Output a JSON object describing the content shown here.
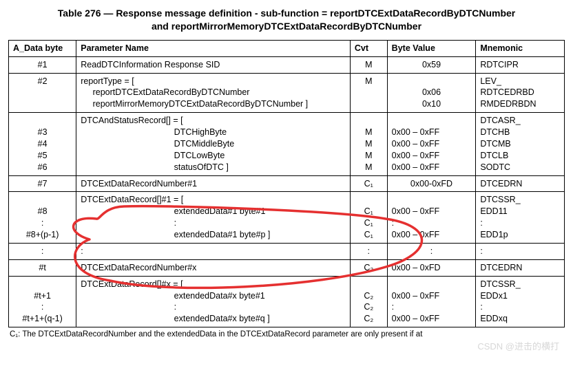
{
  "title_line1": "Table 276 — Response message definition - sub-function = reportDTCExtDataRecordByDTCNumber",
  "title_line2": "and reportMirrorMemoryDTCExtDataRecordByDTCNumber",
  "headers": {
    "a_data_byte": "A_Data byte",
    "parameter_name": "Parameter Name",
    "cvt": "Cvt",
    "byte_value": "Byte Value",
    "mnemonic": "Mnemonic"
  },
  "rows": [
    {
      "a_data_byte": "#1",
      "parameter": "ReadDTCInformation Response SID",
      "cvt": "M",
      "byte_value": "0x59",
      "mnemonic": "RDTCIPR"
    },
    {
      "a_data_byte": "#2",
      "parameter": "reportType = [\n     reportDTCExtDataRecordByDTCNumber\n     reportMirrorMemoryDTCExtDataRecordByDTCNumber ]",
      "cvt": "M",
      "byte_value": "\n0x06\n0x10",
      "mnemonic": "LEV_\nRDTCEDRBD\nRMDEDRBDN"
    },
    {
      "a_data_byte": "\n#3\n#4\n#5\n#6",
      "parameter": "DTCAndStatusRecord[] = [\n                                       DTCHighByte\n                                       DTCMiddleByte\n                                       DTCLowByte\n                                       statusOfDTC ]",
      "cvt": "\nM\nM\nM\nM",
      "byte_value": "\n0x00 – 0xFF\n0x00 – 0xFF\n0x00 – 0xFF\n0x00 – 0xFF",
      "mnemonic": "DTCASR_\nDTCHB\nDTCMB\nDTCLB\nSODTC"
    },
    {
      "a_data_byte": "#7",
      "parameter": "DTCExtDataRecordNumber#1",
      "cvt": "C₁",
      "byte_value": "0x00-0xFD",
      "mnemonic": "DTCEDRN"
    },
    {
      "a_data_byte": "\n#8\n:\n#8+(p-1)",
      "parameter": "DTCExtDataRecord[]#1 = [\n                                       extendedData#1 byte#1\n                                       :\n                                       extendedData#1 byte#p ]",
      "cvt": "\nC₁\nC₁\nC₁",
      "byte_value": "\n0x00 – 0xFF\n:\n0x00 – 0xFF",
      "mnemonic": "DTCSSR_\nEDD11\n:\nEDD1p"
    },
    {
      "a_data_byte": ":",
      "parameter": ":",
      "cvt": ":",
      "byte_value": ":",
      "mnemonic": ":"
    },
    {
      "a_data_byte": "#t",
      "parameter": "DTCExtDataRecordNumber#x",
      "cvt": "C₂",
      "byte_value": "0x00 – 0xFD",
      "mnemonic": "DTCEDRN"
    },
    {
      "a_data_byte": "\n#t+1\n:\n#t+1+(q-1)",
      "parameter": "DTCExtDataRecord[]#x = [\n                                       extendedData#x byte#1\n                                       :\n                                       extendedData#x byte#q ]",
      "cvt": "\nC₂\nC₂\nC₂",
      "byte_value": "\n0x00 – 0xFF\n:\n0x00 – 0xFF",
      "mnemonic": "DTCSSR_\nEDDx1\n:\nEDDxq"
    }
  ],
  "footnote": "C₁: The DTCExtDataRecordNumber and the extendedData in the DTCExtDataRecord parameter are only present if at",
  "watermark": "CSDN @进击的横打",
  "annotation_color": "#e53030"
}
